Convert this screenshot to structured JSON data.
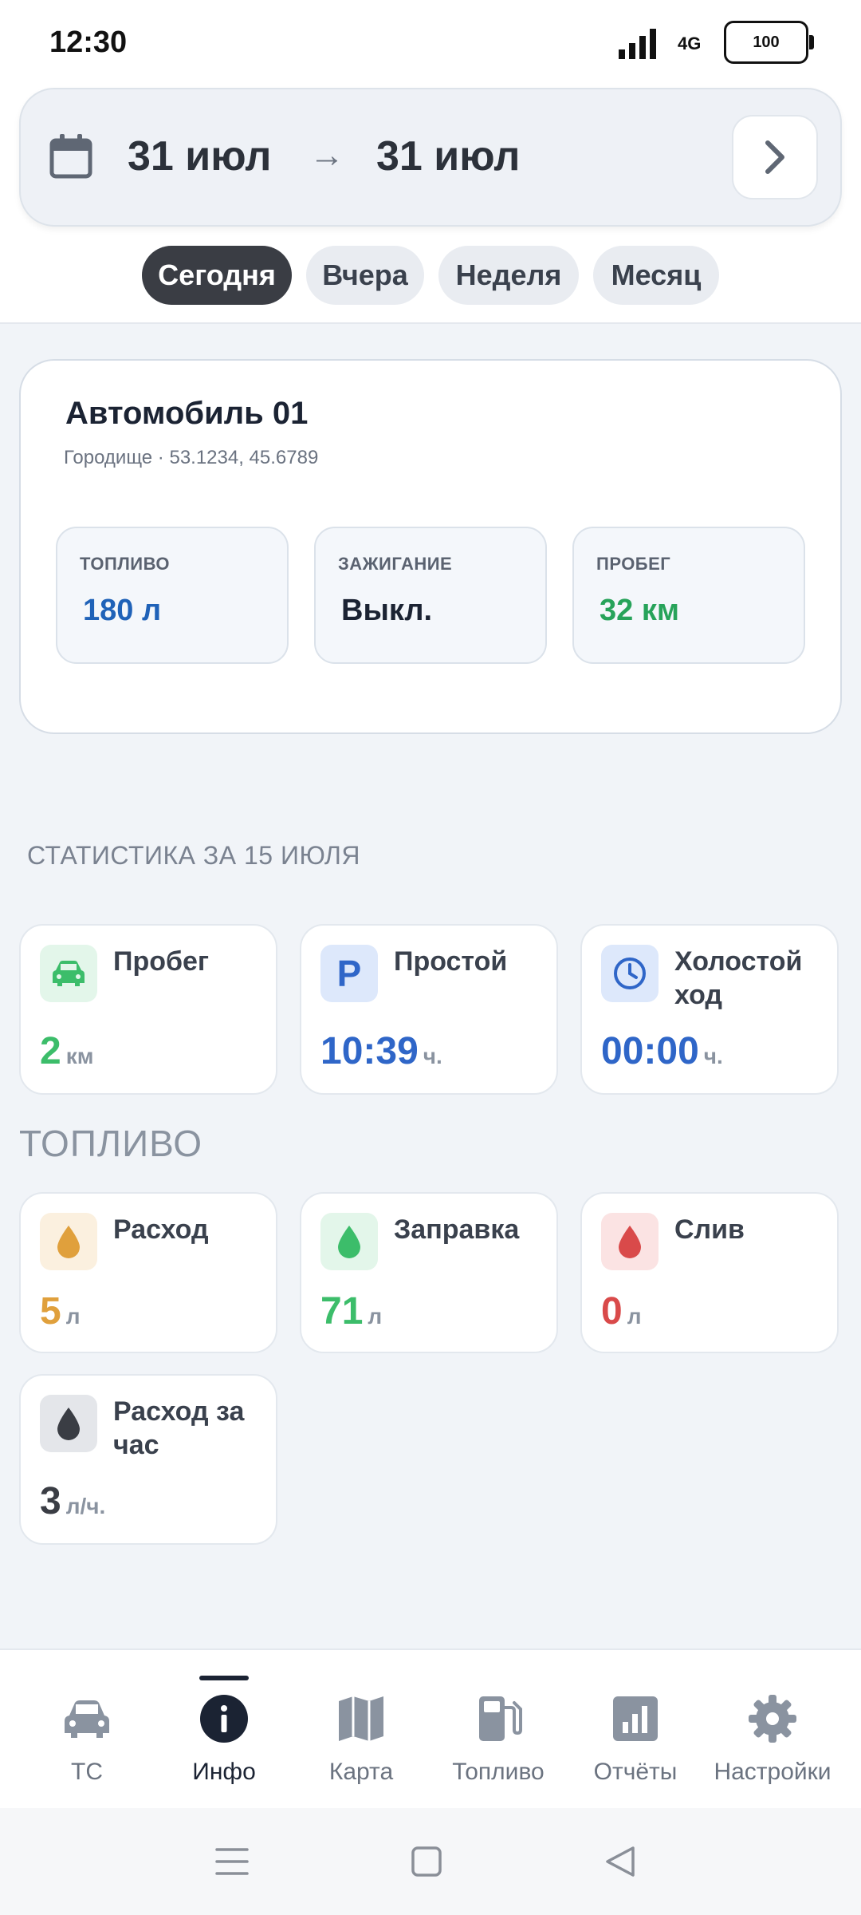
{
  "status": {
    "time": "12:30",
    "network": "4G",
    "battery": "100"
  },
  "date_range": {
    "from": "31 июл",
    "arrow": "→",
    "to": "31 июл"
  },
  "period_tabs": [
    {
      "label": "Сегодня",
      "active": true
    },
    {
      "label": "Вчера",
      "active": false
    },
    {
      "label": "Неделя",
      "active": false
    },
    {
      "label": "Месяц",
      "active": false
    }
  ],
  "vehicle": {
    "name": "Автомобиль 01",
    "location": "Городище · 53.1234, 45.6789",
    "metrics": [
      {
        "label": "ТОПЛИВО",
        "value": "180 л",
        "color": "#1f62b8"
      },
      {
        "label": "ЗАЖИГАНИЕ",
        "value": "Выкл.",
        "color": "#1b2333"
      },
      {
        "label": "ПРОБЕГ",
        "value": "32 км",
        "color": "#27a35a"
      }
    ]
  },
  "stats": {
    "title": "СТАТИСТИКА ЗА 15 ИЮЛЯ",
    "items": [
      {
        "label": "Пробег",
        "value": "2",
        "unit": "км",
        "icon": "car-icon",
        "color": "#3cbd6a"
      },
      {
        "label": "Простой",
        "value": "10:39",
        "unit": "ч.",
        "icon": "parking-icon",
        "color": "#2f66c8"
      },
      {
        "label": "Холостой ход",
        "value": "00:00",
        "unit": "ч.",
        "icon": "clock-icon",
        "color": "#2f66c8"
      }
    ]
  },
  "fuel": {
    "title": "ТОПЛИВО",
    "items": [
      {
        "label": "Расход",
        "value": "5",
        "unit": "л",
        "icon": "drop-icon",
        "color": "#e0a03c"
      },
      {
        "label": "Заправка",
        "value": "71",
        "unit": "л",
        "icon": "drop-icon",
        "color": "#3cbd6a"
      },
      {
        "label": "Слив",
        "value": "0",
        "unit": "л",
        "icon": "drop-icon",
        "color": "#d94a4a"
      },
      {
        "label": "Расход за час",
        "value": "3",
        "unit": "л/ч.",
        "icon": "drop-icon",
        "color": "#3a3d44"
      }
    ]
  },
  "nav": [
    {
      "label": "ТС",
      "icon": "car-icon",
      "active": false
    },
    {
      "label": "Инфо",
      "icon": "info-icon",
      "active": true
    },
    {
      "label": "Карта",
      "icon": "map-icon",
      "active": false
    },
    {
      "label": "Топливо",
      "icon": "fuel-pump-icon",
      "active": false
    },
    {
      "label": "Отчёты",
      "icon": "chart-icon",
      "active": false
    },
    {
      "label": "Настройки",
      "icon": "gear-icon",
      "active": false
    }
  ]
}
